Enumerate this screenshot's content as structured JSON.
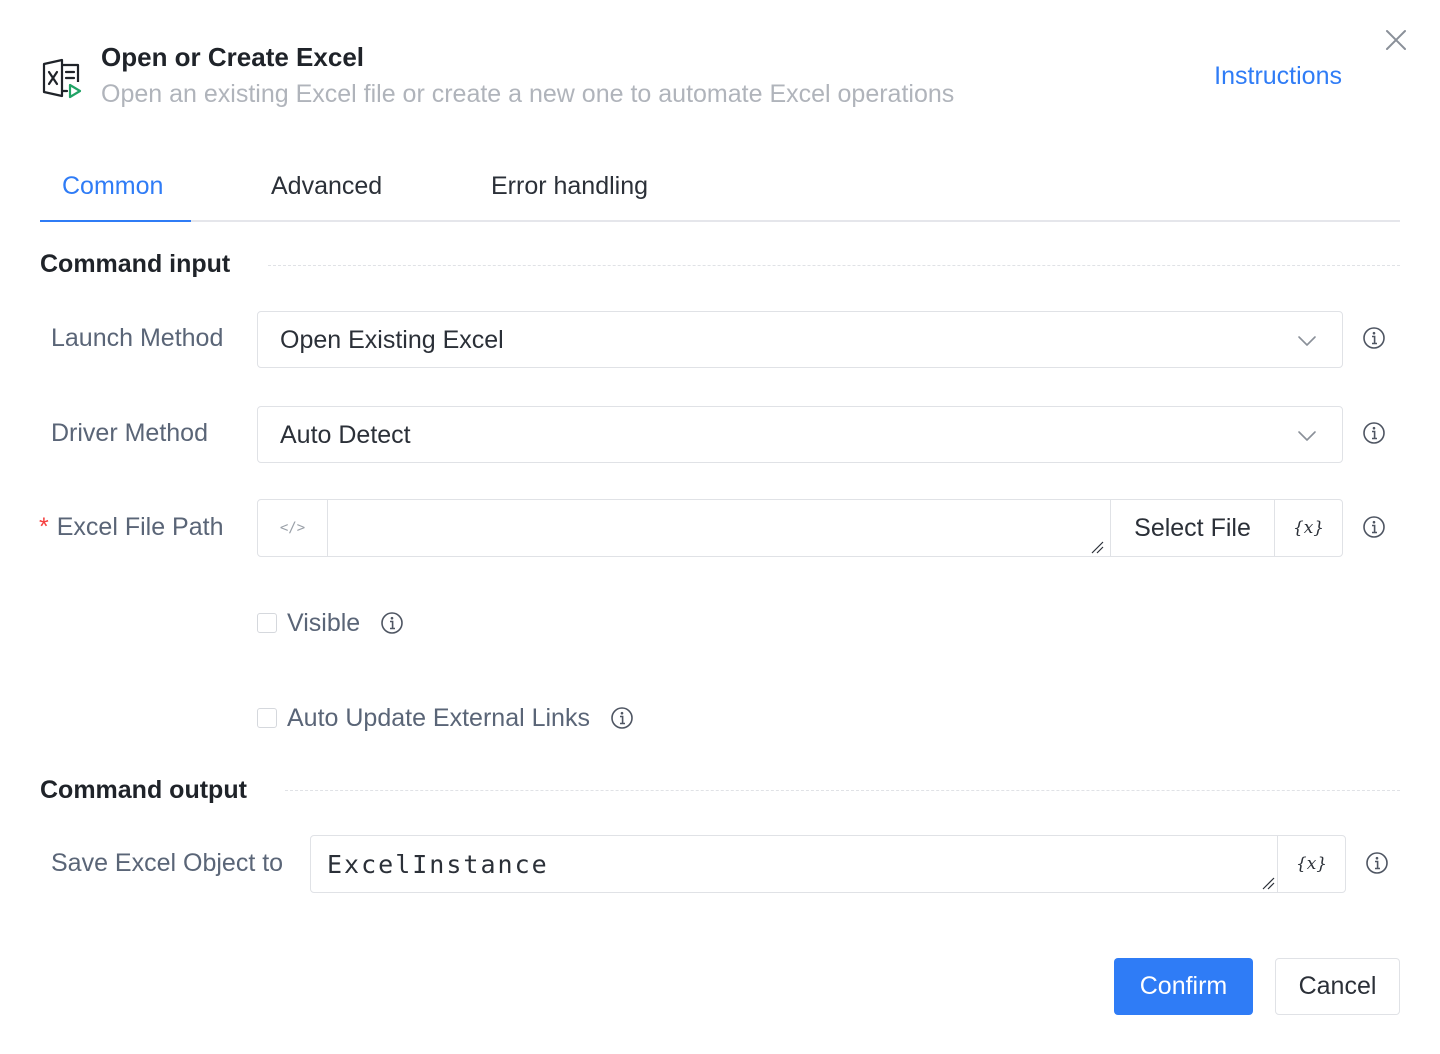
{
  "header": {
    "icon": "excel-file-icon",
    "title": "Open or Create Excel",
    "subtitle": "Open an existing Excel file or create a new one to automate Excel operations",
    "instructions_link": "Instructions",
    "close_icon": "close-icon"
  },
  "tabs": [
    {
      "label": "Common",
      "active": true
    },
    {
      "label": "Advanced",
      "active": false
    },
    {
      "label": "Error handling",
      "active": false
    }
  ],
  "input_section": {
    "title": "Command input",
    "launch_method": {
      "label": "Launch Method",
      "value": "Open Existing Excel"
    },
    "driver_method": {
      "label": "Driver Method",
      "value": "Auto Detect"
    },
    "file_path": {
      "required_mark": "*",
      "label": "Excel File Path",
      "value": "",
      "code_toggle": "</>",
      "select_file_label": "Select File",
      "variable_button": "{x}"
    },
    "visible": {
      "label": "Visible",
      "checked": false
    },
    "auto_update_links": {
      "label": "Auto Update External Links",
      "checked": false
    }
  },
  "output_section": {
    "title": "Command output",
    "save_object": {
      "label": "Save Excel Object to",
      "value": "ExcelInstance",
      "variable_button": "{x}"
    }
  },
  "footer": {
    "confirm_label": "Confirm",
    "cancel_label": "Cancel"
  },
  "colors": {
    "accent": "#2f7cf6",
    "required": "#f53f3f",
    "excel_green": "#21a366"
  }
}
